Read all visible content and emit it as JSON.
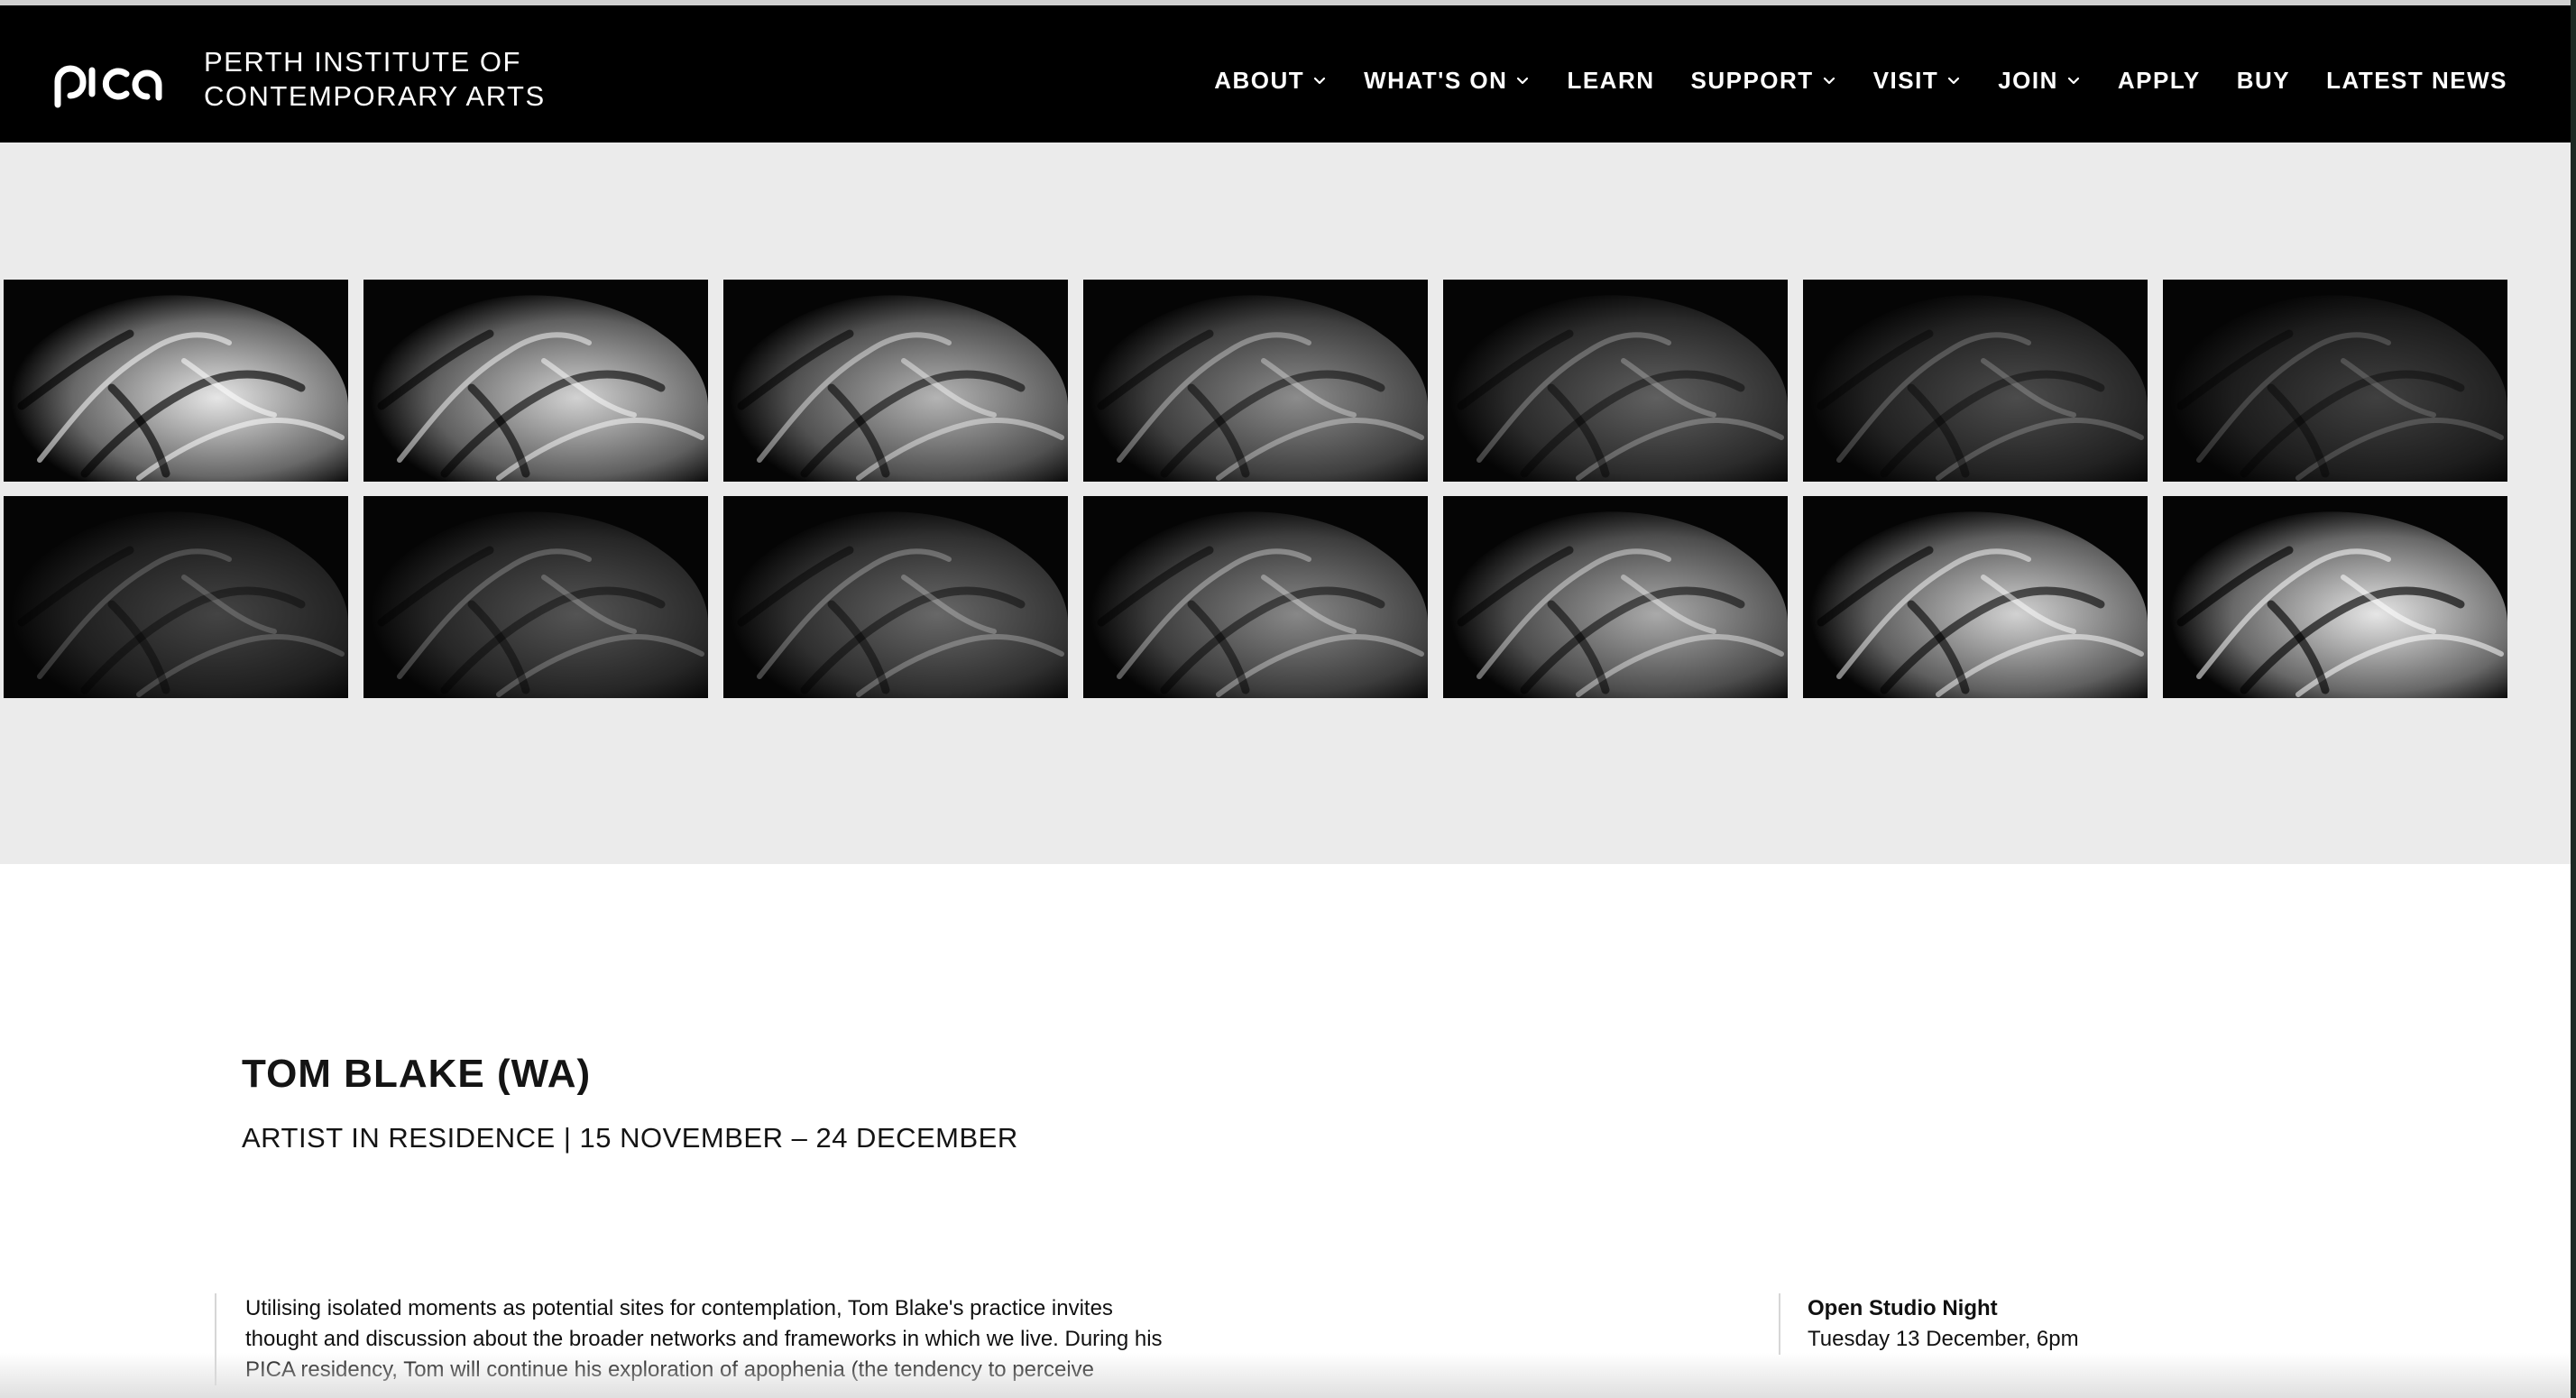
{
  "header": {
    "logo_alt": "PICA",
    "site_name_line1": "PERTH INSTITUTE OF",
    "site_name_line2": "CONTEMPORARY ARTS"
  },
  "nav": {
    "items": [
      {
        "label": "ABOUT",
        "has_dropdown": true
      },
      {
        "label": "WHAT'S ON",
        "has_dropdown": true
      },
      {
        "label": "LEARN",
        "has_dropdown": false
      },
      {
        "label": "SUPPORT",
        "has_dropdown": true
      },
      {
        "label": "VISIT",
        "has_dropdown": true
      },
      {
        "label": "JOIN",
        "has_dropdown": true
      },
      {
        "label": "APPLY",
        "has_dropdown": false
      },
      {
        "label": "BUY",
        "has_dropdown": false
      },
      {
        "label": "LATEST NEWS",
        "has_dropdown": false
      }
    ]
  },
  "gallery": {
    "frames": [
      {
        "brightness": 0.95
      },
      {
        "brightness": 0.85
      },
      {
        "brightness": 0.7
      },
      {
        "brightness": 0.5
      },
      {
        "brightness": 0.28
      },
      {
        "brightness": 0.18
      },
      {
        "brightness": 0.12
      },
      {
        "brightness": 0.14
      },
      {
        "brightness": 0.22
      },
      {
        "brightness": 0.32
      },
      {
        "brightness": 0.48
      },
      {
        "brightness": 0.65
      },
      {
        "brightness": 0.85
      },
      {
        "brightness": 0.95
      }
    ]
  },
  "content": {
    "title": "TOM BLAKE (WA)",
    "subtitle": "ARTIST IN RESIDENCE | 15 NOVEMBER – 24 DECEMBER",
    "body_lines": [
      "Utilising isolated moments as potential sites for contemplation, Tom Blake's practice invites",
      "thought and discussion about the broader networks and frameworks in which we live. During his",
      "PICA residency, Tom will continue his exploration of apophenia (the tendency to perceive"
    ]
  },
  "sidebar": {
    "event_name": "Open Studio Night",
    "event_time": "Tuesday 13 December, 6pm"
  },
  "colors": {
    "header_bg": "#000000",
    "gallery_bg": "#ebebeb",
    "text": "#141414"
  }
}
